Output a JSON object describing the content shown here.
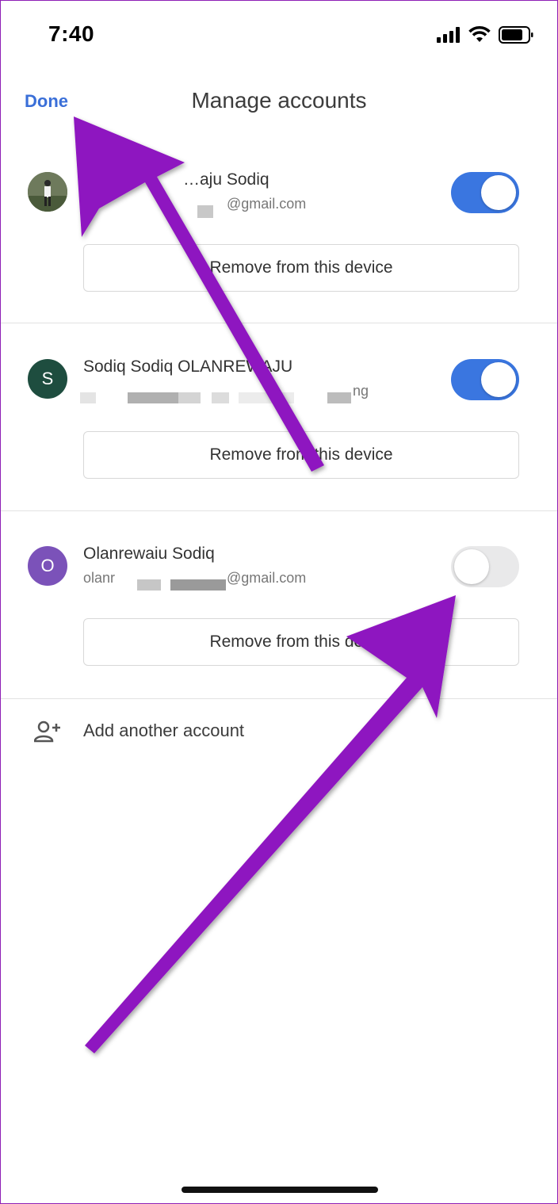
{
  "status_bar": {
    "time": "7:40",
    "icons": [
      "cellular-signal-icon",
      "wifi-icon",
      "battery-icon"
    ]
  },
  "header": {
    "done_label": "Done",
    "title": "Manage accounts"
  },
  "accounts": [
    {
      "name": "…aju Sodiq",
      "email": "@gmail.com",
      "avatar": "photo",
      "toggle": "on",
      "remove_label": "Remove from this device"
    },
    {
      "name": "Sodiq Sodiq OLANREWAJU",
      "email": "ng",
      "avatar_letter": "S",
      "avatar_color": "#1e4d3f",
      "toggle": "on",
      "remove_label": "Remove from this device"
    },
    {
      "name": "Olanrewaiu Sodiq",
      "email": "olanr",
      "email_suffix": "@gmail.com",
      "avatar_letter": "O",
      "avatar_color": "#7b52b9",
      "toggle": "off",
      "remove_label": "Remove from this device"
    }
  ],
  "add_account": {
    "label": "Add another account",
    "icon": "add-person-icon"
  },
  "colors": {
    "accent": "#3a76e0",
    "annotation_arrow": "#8e12c0"
  }
}
